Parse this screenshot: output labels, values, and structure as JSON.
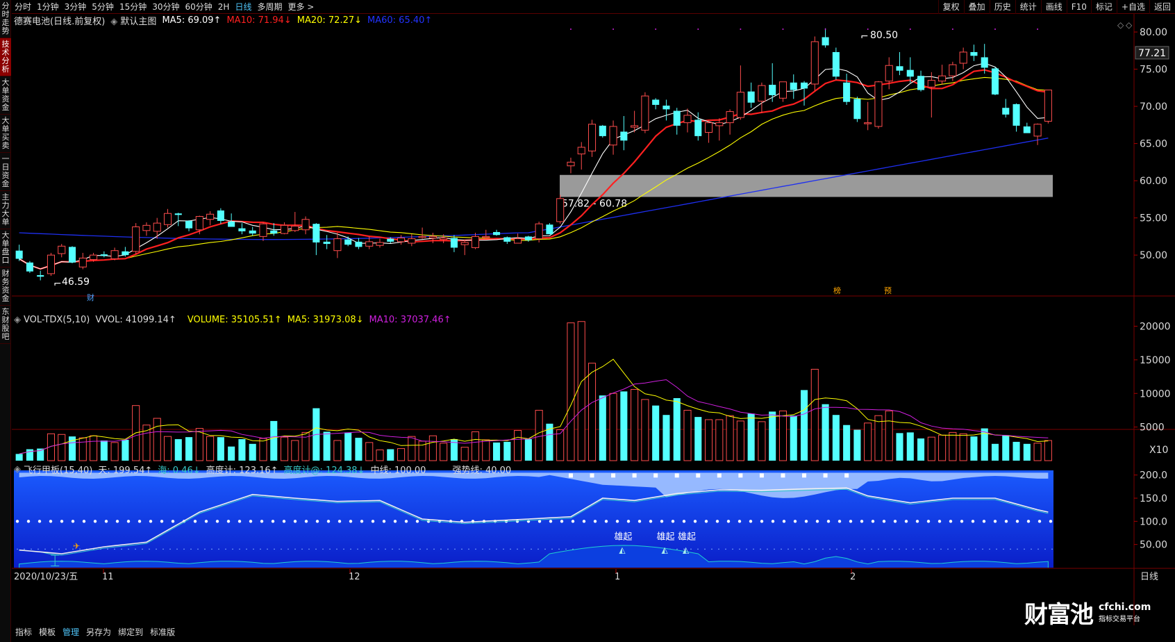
{
  "sidebar": {
    "items": [
      {
        "label": "分时走势",
        "active": false
      },
      {
        "label": "技术分析",
        "active": true
      },
      {
        "label": "大单资金",
        "active": false
      },
      {
        "label": "大单买卖",
        "active": false
      },
      {
        "label": "一日资金",
        "active": false
      },
      {
        "label": "主力大单",
        "active": false
      },
      {
        "label": "大单盘口",
        "active": false
      },
      {
        "label": "财务资金",
        "active": false
      },
      {
        "label": "东财股吧",
        "active": false
      }
    ]
  },
  "toolbar": {
    "periods": [
      "分时",
      "1分钟",
      "3分钟",
      "5分钟",
      "15分钟",
      "30分钟",
      "60分钟",
      "2H",
      "日线",
      "多周期",
      "更多 >"
    ],
    "active_period": "日线",
    "right": [
      "复权",
      "叠加",
      "历史",
      "统计",
      "画线",
      "F10",
      "标记",
      "+自选",
      "返回"
    ]
  },
  "main_info": {
    "stock": "德赛电池(日线.前复权)",
    "mode": "默认主图",
    "ma5": "MA5: 69.09↑",
    "ma10": "MA10: 71.94↓",
    "ma20": "MA20: 72.27↓",
    "ma60": "MA60: 65.40↑"
  },
  "volume_info": {
    "title": "VOL-TDX(5,10)",
    "vvol": "VVOL: 41099.14↑",
    "volume": "VOLUME: 35105.51↑",
    "ma5": "MA5: 31973.08↓",
    "ma10": "MA10: 37037.46↑"
  },
  "indicator_info": {
    "title": "飞行甲板(15,40)",
    "tian": "天: 199.54↑",
    "hai": "海: 0.46↓",
    "gaodu": "高度计: 123.16↑",
    "gaodu_at": "高度计@: 124.38↓",
    "zhongxian": "中线: 100.00",
    "qiangshi": "强势线: 40.00"
  },
  "annotations": {
    "high": "80.50",
    "low": "46.59",
    "zone": "57.82 - 60.78",
    "current_price": "77.21",
    "vol_unit": "X10",
    "pioneer": [
      "雄起",
      "雄起",
      "雄起"
    ],
    "event_cai": "财",
    "event_bang": "榜",
    "event_yu": "预"
  },
  "axes": {
    "price_ticks": [
      "80.00",
      "75.00",
      "70.00",
      "65.00",
      "60.00",
      "55.00",
      "50.00"
    ],
    "volume_ticks": [
      "20000",
      "15000",
      "10000",
      "5000"
    ],
    "indicator_ticks": [
      "200.0",
      "150.0",
      "100.0",
      "50.00"
    ],
    "dates": [
      "2020/10/23/五",
      "11",
      "12",
      "1",
      "2",
      "日线"
    ]
  },
  "bottom_tabs": [
    "指标",
    "模板",
    "管理",
    "另存为",
    "绑定到",
    "标准版"
  ],
  "bottom_active": "管理",
  "logo": {
    "brand": "财富池",
    "domain": "cfchi.com",
    "sub": "指标交易平台"
  },
  "colors": {
    "up": "#ff4d4d",
    "down": "#54ffff",
    "ma5": "#ffffff",
    "ma10": "#ff2020",
    "ma20": "#ffff00",
    "ma60": "#1e2ff0",
    "vol_ma10": "#d020e0"
  },
  "chart_data": {
    "type": "candlestick",
    "ylim": [
      44.5,
      81.5
    ],
    "candles": [
      [
        50.6,
        51.4,
        49.2,
        49.5
      ],
      [
        49.0,
        49.2,
        47.6,
        47.8
      ],
      [
        47.3,
        47.9,
        46.6,
        47.1
      ],
      [
        47.5,
        50.3,
        47.2,
        50.0
      ],
      [
        50.2,
        51.5,
        49.7,
        51.2
      ],
      [
        51.1,
        51.2,
        48.9,
        49.0
      ],
      [
        48.4,
        50.3,
        48.1,
        49.6
      ],
      [
        49.4,
        50.3,
        49.1,
        50.0
      ],
      [
        50.1,
        50.5,
        49.7,
        49.9
      ],
      [
        49.5,
        51.0,
        49.3,
        50.6
      ],
      [
        50.5,
        51.1,
        49.8,
        50.0
      ],
      [
        50.5,
        54.3,
        50.1,
        53.8
      ],
      [
        53.3,
        54.4,
        52.6,
        54.0
      ],
      [
        53.2,
        55.0,
        52.2,
        54.3
      ],
      [
        54.1,
        56.2,
        53.7,
        55.6
      ],
      [
        55.6,
        55.7,
        53.9,
        55.4
      ],
      [
        54.6,
        54.7,
        53.2,
        53.6
      ],
      [
        53.4,
        55.3,
        52.8,
        55.2
      ],
      [
        54.8,
        55.9,
        54.0,
        55.5
      ],
      [
        56.0,
        56.3,
        54.2,
        54.6
      ],
      [
        54.5,
        55.6,
        54.3,
        53.8
      ],
      [
        53.6,
        54.3,
        52.8,
        53.2
      ],
      [
        53.3,
        53.8,
        52.6,
        52.9
      ],
      [
        52.5,
        54.4,
        51.9,
        54.2
      ],
      [
        53.3,
        54.3,
        52.6,
        52.9
      ],
      [
        52.9,
        54.4,
        52.8,
        54.0
      ],
      [
        53.3,
        55.8,
        53.1,
        53.9
      ],
      [
        53.4,
        55.2,
        52.8,
        54.8
      ],
      [
        54.2,
        54.3,
        50.0,
        51.7
      ],
      [
        51.8,
        52.7,
        50.8,
        51.5
      ],
      [
        50.6,
        53.0,
        49.6,
        52.2
      ],
      [
        52.1,
        52.5,
        51.2,
        51.4
      ],
      [
        51.8,
        52.3,
        50.8,
        51.1
      ],
      [
        51.2,
        52.5,
        50.8,
        51.8
      ],
      [
        51.3,
        52.2,
        51.0,
        51.7
      ],
      [
        52.2,
        52.4,
        51.6,
        51.8
      ],
      [
        51.8,
        52.7,
        51.4,
        52.3
      ],
      [
        51.6,
        52.8,
        51.2,
        52.2
      ],
      [
        52.4,
        53.7,
        52.2,
        52.5
      ],
      [
        52.3,
        53.0,
        51.6,
        52.5
      ],
      [
        52.1,
        52.8,
        51.6,
        52.3
      ],
      [
        52.3,
        52.7,
        50.4,
        51.0
      ],
      [
        51.4,
        52.1,
        50.0,
        51.7
      ],
      [
        51.0,
        53.0,
        50.8,
        52.5
      ],
      [
        52.5,
        53.4,
        52.2,
        52.5
      ],
      [
        53.1,
        53.4,
        52.6,
        52.7
      ],
      [
        52.4,
        52.5,
        51.5,
        51.8
      ],
      [
        51.6,
        52.9,
        51.6,
        52.2
      ],
      [
        52.5,
        52.6,
        51.8,
        52.0
      ],
      [
        52.2,
        54.5,
        51.7,
        54.2
      ],
      [
        54.1,
        54.3,
        52.8,
        52.8
      ],
      [
        54.5,
        58.1,
        54.2,
        57.6
      ],
      [
        62.0,
        63.1,
        61.0,
        62.5
      ],
      [
        63.6,
        65.2,
        61.5,
        64.5
      ],
      [
        64.0,
        68.2,
        63.2,
        67.6
      ],
      [
        67.4,
        67.5,
        65.8,
        66.0
      ],
      [
        64.8,
        68.1,
        63.5,
        67.3
      ],
      [
        66.6,
        68.7,
        64.1,
        65.4
      ],
      [
        67.2,
        69.4,
        66.5,
        67.4
      ],
      [
        66.8,
        71.9,
        66.4,
        71.4
      ],
      [
        70.9,
        71.1,
        69.6,
        70.2
      ],
      [
        70.1,
        70.9,
        68.1,
        69.6
      ],
      [
        69.4,
        69.8,
        66.2,
        67.4
      ],
      [
        67.8,
        69.7,
        66.5,
        68.8
      ],
      [
        68.2,
        69.2,
        65.4,
        66.0
      ],
      [
        66.5,
        68.1,
        65.1,
        67.8
      ],
      [
        67.4,
        68.4,
        65.4,
        67.8
      ],
      [
        67.8,
        69.6,
        66.2,
        69.3
      ],
      [
        68.5,
        75.5,
        68.2,
        71.9
      ],
      [
        72.0,
        73.2,
        69.8,
        70.5
      ],
      [
        70.7,
        73.2,
        69.1,
        72.8
      ],
      [
        72.9,
        75.8,
        70.6,
        71.5
      ],
      [
        71.1,
        73.3,
        70.6,
        73.3
      ],
      [
        73.2,
        74.3,
        71.0,
        72.2
      ],
      [
        73.2,
        73.4,
        70.1,
        72.4
      ],
      [
        73.0,
        79.4,
        72.1,
        78.7
      ],
      [
        79.3,
        80.5,
        77.9,
        78.2
      ],
      [
        77.3,
        77.9,
        73.6,
        74.0
      ],
      [
        73.2,
        74.4,
        70.2,
        70.6
      ],
      [
        71.0,
        71.3,
        67.9,
        68.3
      ],
      [
        67.8,
        70.6,
        66.8,
        67.8
      ],
      [
        67.3,
        73.4,
        67.0,
        73.3
      ],
      [
        73.4,
        76.6,
        72.3,
        75.5
      ],
      [
        75.4,
        77.3,
        74.2,
        74.8
      ],
      [
        74.9,
        76.6,
        73.2,
        74.0
      ],
      [
        74.1,
        74.8,
        72.0,
        72.2
      ],
      [
        72.6,
        74.6,
        68.5,
        73.5
      ],
      [
        73.4,
        75.6,
        72.9,
        74.1
      ],
      [
        74.1,
        76.0,
        73.4,
        75.6
      ],
      [
        75.8,
        77.9,
        75.0,
        77.3
      ],
      [
        77.3,
        78.3,
        76.1,
        76.8
      ],
      [
        76.6,
        78.4,
        74.4,
        75.2
      ],
      [
        75.1,
        75.3,
        71.5,
        71.6
      ],
      [
        69.8,
        71.0,
        68.5,
        68.9
      ],
      [
        70.3,
        70.4,
        66.6,
        67.4
      ],
      [
        67.3,
        67.8,
        66.5,
        66.4
      ],
      [
        66.0,
        67.7,
        64.8,
        67.6
      ],
      [
        68.0,
        72.1,
        67.7,
        72.2
      ]
    ],
    "volume": [
      1000,
      1700,
      1800,
      4000,
      3900,
      3600,
      3400,
      3700,
      3000,
      2700,
      3100,
      8200,
      5300,
      6300,
      3600,
      3200,
      3500,
      4800,
      3600,
      3500,
      2100,
      3200,
      2500,
      3300,
      5900,
      3500,
      3000,
      4200,
      7800,
      4300,
      3000,
      4200,
      3400,
      2700,
      1600,
      1700,
      1800,
      3600,
      2900,
      3700,
      2600,
      3200,
      2000,
      4300,
      3100,
      2700,
      2800,
      4500,
      3200,
      7500,
      5500,
      4600,
      20500,
      20700,
      14500,
      9700,
      10000,
      10300,
      10600,
      9100,
      8200,
      6800,
      9300,
      7500,
      6500,
      6100,
      6100,
      6700,
      5900,
      7000,
      5800,
      7300,
      7400,
      6700,
      10500,
      13600,
      8400,
      6800,
      5300,
      4600,
      5600,
      6700,
      7400,
      4100,
      4200,
      3300,
      3500,
      3800,
      4200,
      4000,
      3600,
      4800,
      2500,
      3800,
      2800,
      2500,
      2600,
      3000
    ],
    "indicator_ticks_values": [
      200,
      150,
      100,
      50
    ]
  }
}
